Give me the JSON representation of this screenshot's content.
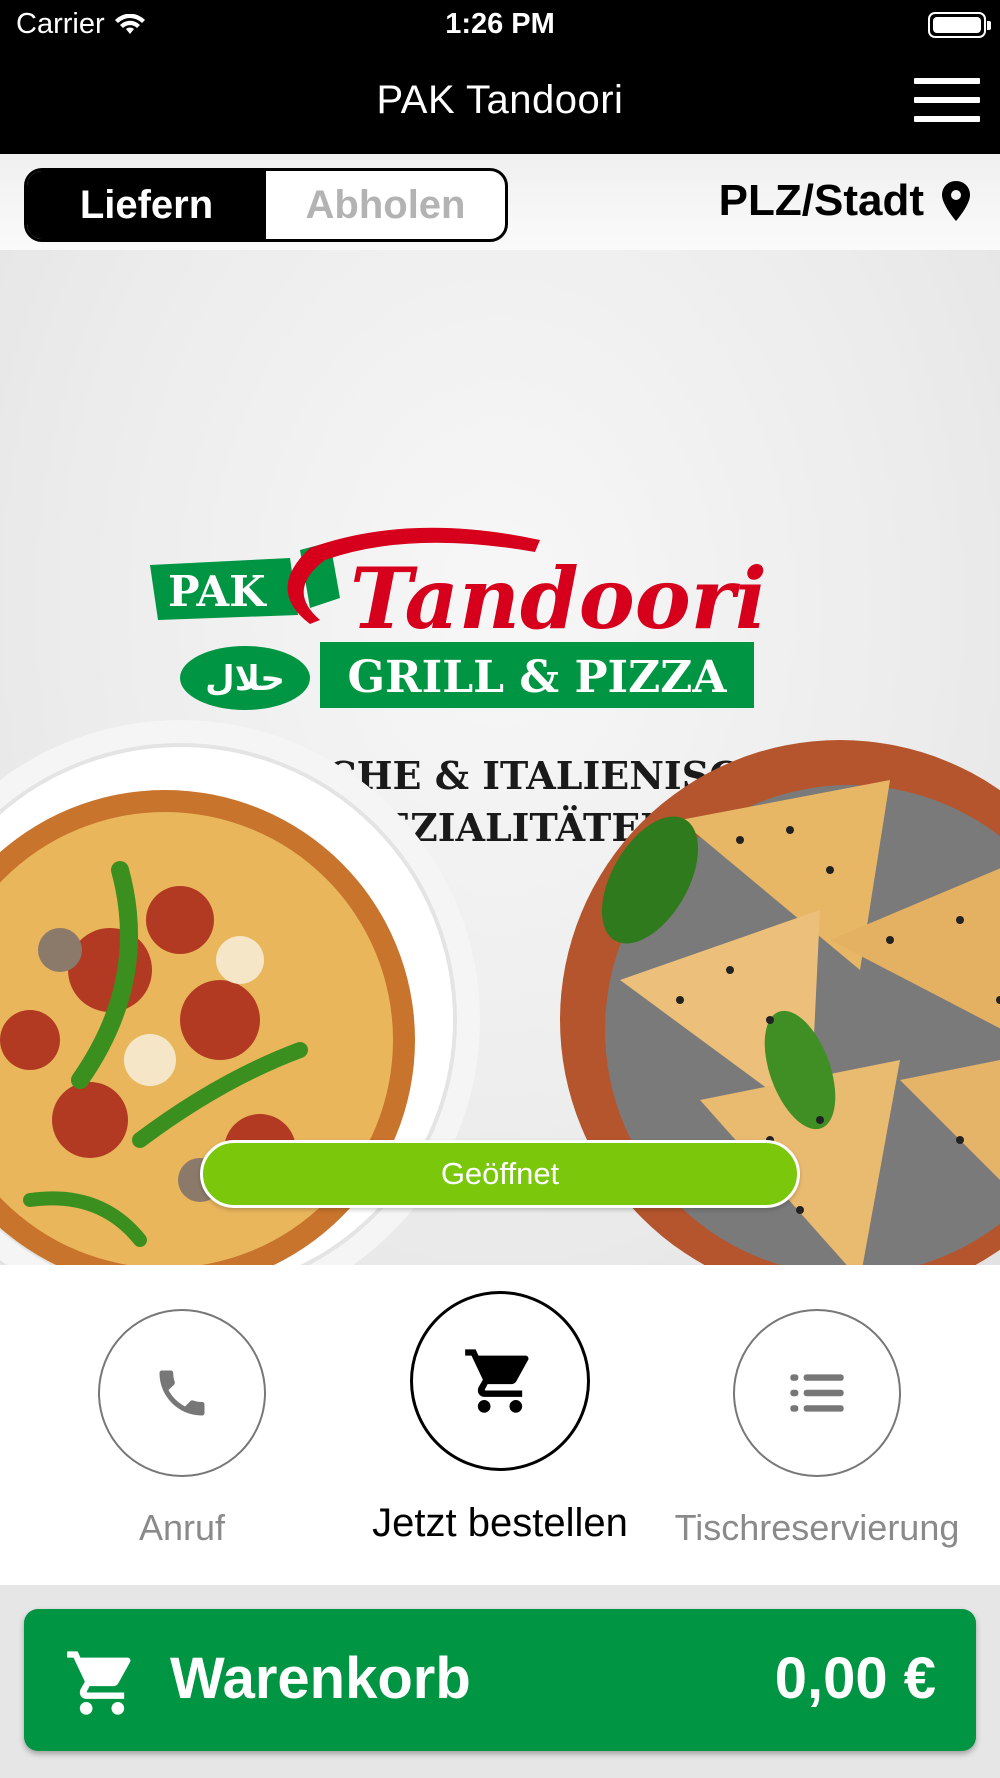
{
  "status_bar": {
    "carrier": "Carrier",
    "time": "1:26 PM",
    "wifi_icon": "wifi-icon",
    "battery_icon": "battery-icon"
  },
  "nav": {
    "title": "PAK Tandoori",
    "menu_icon": "hamburger-menu-icon"
  },
  "order_mode": {
    "options": [
      "Liefern",
      "Abholen"
    ],
    "selected": "Liefern"
  },
  "location": {
    "label": "PLZ/Stadt",
    "icon": "map-pin-icon"
  },
  "hero": {
    "logo_text": "PAK Tandoori GRILL & PIZZA حلال",
    "tagline_line1": "INDISCHE & ITALIENISCHE",
    "tagline_line2": "SPEZIALITÄTEN",
    "status_badge": "Geöffnet"
  },
  "actions": [
    {
      "label": "Anruf",
      "icon": "phone-icon"
    },
    {
      "label": "Jetzt bestellen",
      "icon": "cart-icon"
    },
    {
      "label": "Tischreservierung",
      "icon": "list-icon"
    }
  ],
  "cart": {
    "label": "Warenkorb",
    "total": "0,00 €",
    "icon": "cart-icon"
  },
  "colors": {
    "brand_green": "#009543",
    "open_green": "#7ac70c",
    "logo_red": "#d6001c",
    "nav_black": "#000000"
  }
}
